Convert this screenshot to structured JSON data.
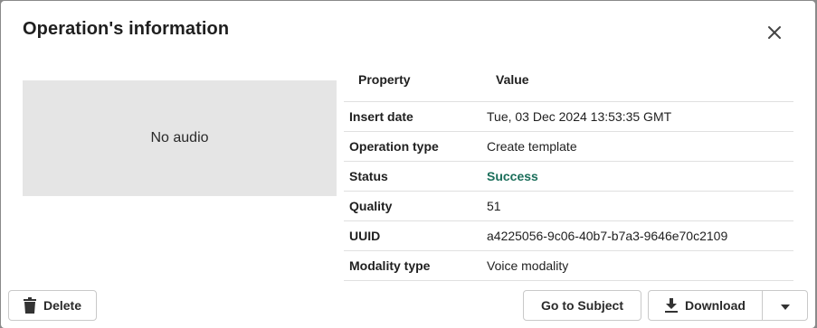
{
  "dialog": {
    "title": "Operation's information"
  },
  "audio": {
    "placeholder": "No audio"
  },
  "table": {
    "headers": {
      "property": "Property",
      "value": "Value"
    },
    "rows": [
      {
        "property": "Insert date",
        "value": "Tue, 03 Dec 2024 13:53:35 GMT"
      },
      {
        "property": "Operation type",
        "value": "Create template"
      },
      {
        "property": "Status",
        "value": "Success"
      },
      {
        "property": "Quality",
        "value": "51"
      },
      {
        "property": "UUID",
        "value": "a4225056-9c06-40b7-b7a3-9646e70c2109"
      },
      {
        "property": "Modality type",
        "value": "Voice modality"
      }
    ]
  },
  "actions": {
    "delete_label": "Delete",
    "go_to_subject_label": "Go to Subject",
    "download_label": "Download"
  },
  "colors": {
    "status_success": "#1b6e5a",
    "audio_bg": "#e5e5e5"
  },
  "icons": {
    "close": "close-icon",
    "delete": "trash-icon",
    "download": "download-icon",
    "dropdown": "caret-down-icon"
  }
}
